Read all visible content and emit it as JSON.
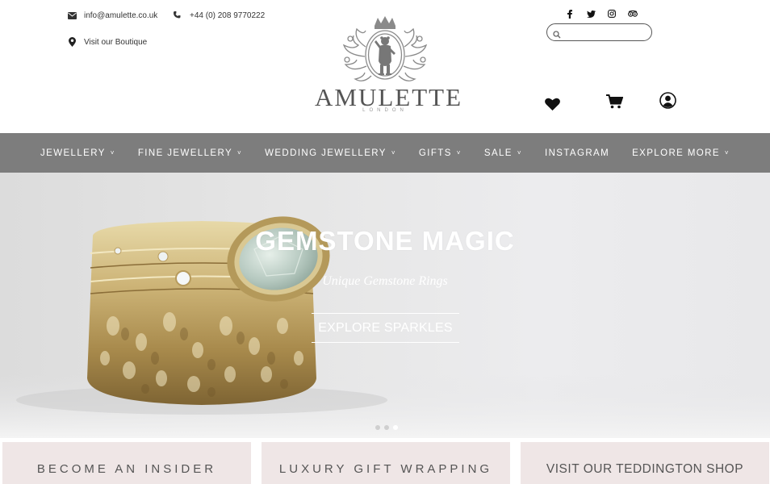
{
  "header": {
    "email": "info@amulette.co.uk",
    "phone": "+44 (0) 208 9770222",
    "visit": "Visit our Boutique",
    "brand": "AMULETTE",
    "brand_sub": "LONDON",
    "search_placeholder": "",
    "social": [
      "facebook-icon",
      "twitter-icon",
      "instagram-icon",
      "tripadvisor-icon"
    ],
    "icons": [
      "heart-icon",
      "cart-icon",
      "user-icon"
    ]
  },
  "nav": {
    "items": [
      {
        "label": "JEWELLERY",
        "dropdown": true
      },
      {
        "label": "FINE JEWELLERY",
        "dropdown": true
      },
      {
        "label": "WEDDING JEWELLERY",
        "dropdown": true
      },
      {
        "label": "GIFTS",
        "dropdown": true
      },
      {
        "label": "SALE",
        "dropdown": true
      },
      {
        "label": "INSTAGRAM",
        "dropdown": false
      },
      {
        "label": "EXPLORE MORE",
        "dropdown": true
      }
    ],
    "background": "#7d7d7d"
  },
  "hero": {
    "title": "GEMSTONE MAGIC",
    "subtitle": "Unique Gemstone Rings",
    "button": "EXPLORE SPARKLES",
    "slides": 3,
    "active_slide": 3
  },
  "features": {
    "items": [
      {
        "title": "BECOME AN INSIDER"
      },
      {
        "title": "LUXURY GIFT WRAPPING"
      },
      {
        "title": "VISIT OUR TEDDINGTON SHOP"
      }
    ],
    "background": "#efe6e6"
  }
}
